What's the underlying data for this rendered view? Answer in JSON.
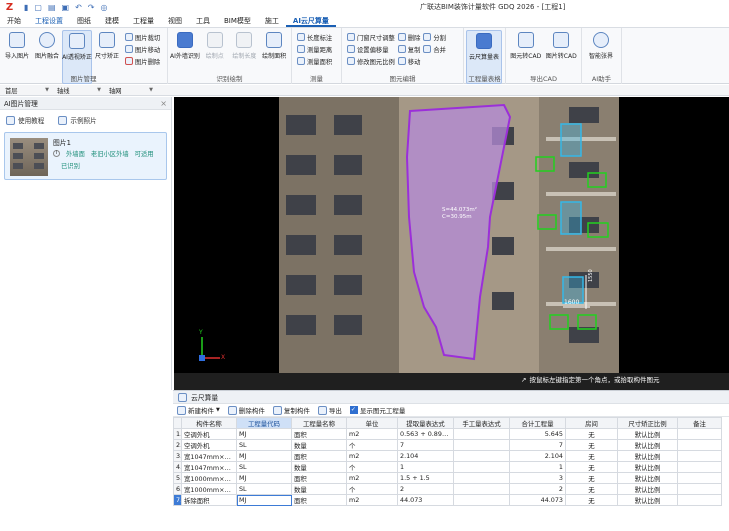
{
  "titlebar": {
    "logo": "Z",
    "title": "广联达BIM装饰计量软件 GDQ 2026 - [工程1]",
    "quick_icons": [
      "▮",
      "▢",
      "▤",
      "▣",
      "↶",
      "↷",
      "◎"
    ]
  },
  "menu": {
    "items": [
      "开始",
      "工程设置",
      "图纸",
      "建模",
      "工程量",
      "视图",
      "工具",
      "BIM模型",
      "施工",
      "AI云尺算量"
    ],
    "active_index": 9
  },
  "ribbon": {
    "groups": [
      {
        "label": "图片管理",
        "big": [
          "导入图片",
          "图片融合",
          "AI透视矫正",
          "尺寸矫正"
        ],
        "small": [
          "图片裁切",
          "图片移动",
          "图片删除"
        ]
      },
      {
        "label": "识别绘制",
        "big": [
          "AI外墙识别",
          "绘制点",
          "绘制长度",
          "绘制面积"
        ]
      },
      {
        "label": "测量",
        "small": [
          "长度标注",
          "测量距离",
          "测量面积"
        ]
      },
      {
        "label": "图元编辑",
        "small": [
          "门窗尺寸调整",
          "设置偏移量",
          "修改图元比例",
          "删除",
          "复制",
          "移动",
          "分割",
          "合并"
        ]
      },
      {
        "label": "工程量表格",
        "big": [
          "云尺算量表"
        ]
      },
      {
        "label": "导出CAD",
        "big": [
          "图元转CAD",
          "图片转CAD"
        ]
      },
      {
        "label": "AI助手",
        "big": [
          "智能张界"
        ]
      }
    ]
  },
  "propbar": {
    "dropdowns": [
      "首层",
      "轴线",
      "轴网"
    ]
  },
  "leftpanel": {
    "title": "AI图片管理",
    "close": "×",
    "tutorial": "使用教程",
    "sample": "示例照片",
    "card": {
      "name": "图片1",
      "tag": "外墙面",
      "source": "老旧小区外墙",
      "usable": "可适用",
      "status": "已识别"
    }
  },
  "canvas": {
    "hint": "按鼠标左键指定第一个角点，或拾取构件图元",
    "area_text": "S=44.073m²",
    "area_sub": "C=30.95m",
    "dim_a": "1600",
    "dim_b": "1550",
    "axis_x": "X",
    "axis_y": "Y"
  },
  "bottom": {
    "title": "云尺算量",
    "toolbar": {
      "new": "新建构件",
      "delete": "删除构件",
      "copy": "复制构件",
      "export": "导出",
      "show_qty": "显示图元工程量"
    },
    "columns": [
      "构件名称",
      "工程量代码",
      "工程量名称",
      "单位",
      "提取量表达式",
      "手工量表达式",
      "合计工程量",
      "房间",
      "尺寸矫正比例",
      "备注"
    ],
    "rows": [
      {
        "no": "1",
        "name": "空调外机",
        "code": "MJ",
        "qname": "面积",
        "unit": "m2",
        "expr": "0.563 + 0.897 ...",
        "manual": "",
        "total": "5.645",
        "room": "无",
        "ratio": "默认比例",
        "note": ""
      },
      {
        "no": "2",
        "name": "空调外机",
        "code": "SL",
        "qname": "数量",
        "unit": "个",
        "expr": "7",
        "manual": "",
        "total": "7",
        "room": "无",
        "ratio": "默认比例",
        "note": ""
      },
      {
        "no": "3",
        "name": "宽1047mm×高...",
        "code": "MJ",
        "qname": "面积",
        "unit": "m2",
        "expr": "2.104",
        "manual": "",
        "total": "2.104",
        "room": "无",
        "ratio": "默认比例",
        "note": ""
      },
      {
        "no": "4",
        "name": "宽1047mm×高...",
        "code": "SL",
        "qname": "数量",
        "unit": "个",
        "expr": "1",
        "manual": "",
        "total": "1",
        "room": "无",
        "ratio": "默认比例",
        "note": ""
      },
      {
        "no": "5",
        "name": "宽1000mm×高...",
        "code": "MJ",
        "qname": "面积",
        "unit": "m2",
        "expr": "1.5 + 1.5",
        "manual": "",
        "total": "3",
        "room": "无",
        "ratio": "默认比例",
        "note": ""
      },
      {
        "no": "6",
        "name": "宽1000mm×高...",
        "code": "SL",
        "qname": "数量",
        "unit": "个",
        "expr": "2",
        "manual": "",
        "total": "2",
        "room": "无",
        "ratio": "默认比例",
        "note": ""
      },
      {
        "no": "7",
        "name": "拆除面积",
        "code": "MJ",
        "qname": "面积",
        "unit": "m2",
        "expr": "44.073",
        "manual": "",
        "total": "44.073",
        "room": "无",
        "ratio": "默认比例",
        "note": ""
      }
    ]
  },
  "colors": {
    "accent": "#1a5fb4",
    "selection_purple": "#9b2fd9",
    "window_green": "#22d11f",
    "window_cyan": "#34b8e8"
  }
}
